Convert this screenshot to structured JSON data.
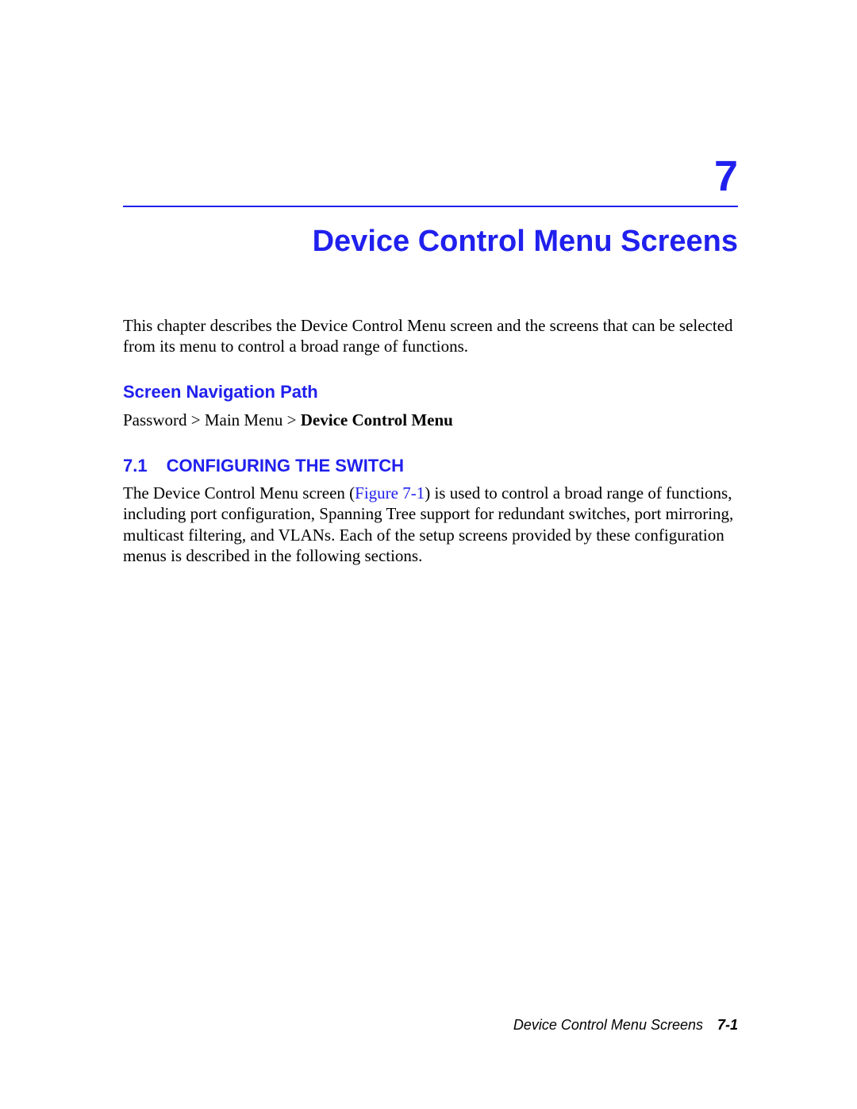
{
  "chapter": {
    "number": "7",
    "title": "Device Control Menu Screens",
    "intro": "This chapter describes the Device Control Menu screen and the screens that can be selected from its menu to control a broad range of functions."
  },
  "navPath": {
    "heading": "Screen Navigation Path",
    "prefix": "Password > Main Menu > ",
    "bold": "Device Control Menu"
  },
  "section": {
    "number": "7.1",
    "title": "CONFIGURING THE SWITCH",
    "para_pre": "The Device Control Menu screen (",
    "figure_link": "Figure 7-1",
    "para_post": ") is used to control a broad range of functions, including port configuration, Spanning Tree support for redundant switches, port mirroring, multicast filtering, and VLANs. Each of the setup screens provided by these configuration menus is described in the following sections."
  },
  "footer": {
    "label": "Device Control Menu Screens",
    "page": "7-1"
  }
}
